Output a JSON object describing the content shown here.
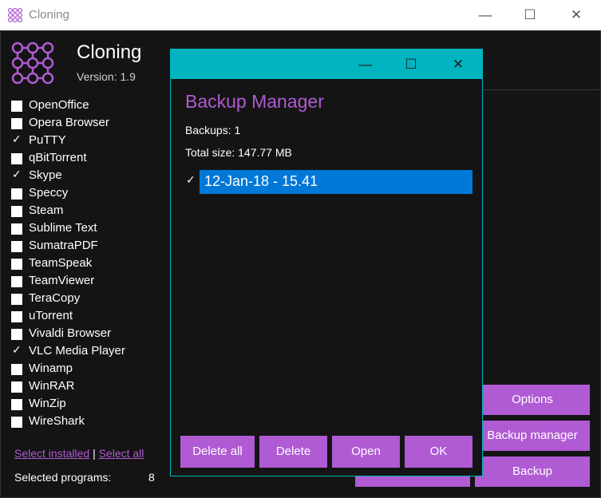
{
  "window": {
    "title": "Cloning"
  },
  "header": {
    "app_name": "Cloning",
    "version": "Version: 1.9"
  },
  "programs": [
    {
      "label": "OpenOffice",
      "checked": false
    },
    {
      "label": "Opera Browser",
      "checked": false
    },
    {
      "label": "PuTTY",
      "checked": true
    },
    {
      "label": "qBitTorrent",
      "checked": false
    },
    {
      "label": "Skype",
      "checked": true
    },
    {
      "label": "Speccy",
      "checked": false
    },
    {
      "label": "Steam",
      "checked": false
    },
    {
      "label": "Sublime Text",
      "checked": false
    },
    {
      "label": "SumatraPDF",
      "checked": false
    },
    {
      "label": "TeamSpeak",
      "checked": false
    },
    {
      "label": "TeamViewer",
      "checked": false
    },
    {
      "label": "TeraCopy",
      "checked": false
    },
    {
      "label": "uTorrent",
      "checked": false
    },
    {
      "label": "Vivaldi Browser",
      "checked": false
    },
    {
      "label": "VLC Media Player",
      "checked": true
    },
    {
      "label": "Winamp",
      "checked": false
    },
    {
      "label": "WinRAR",
      "checked": false
    },
    {
      "label": "WinZip",
      "checked": false
    },
    {
      "label": "WireShark",
      "checked": false
    }
  ],
  "links": {
    "select_installed": "Select installed",
    "separator": "|",
    "select_all": "Select all"
  },
  "selection": {
    "label": "Selected programs:",
    "count": "8"
  },
  "buttons": {
    "options": "Options",
    "backup_manager": "Backup manager",
    "backup": "Backup"
  },
  "colors": {
    "accent": "#b05ad4",
    "dialog_title": "#00b4c0",
    "selection": "#0078d7",
    "background": "#141414"
  },
  "dialog": {
    "heading": "Backup Manager",
    "backups_count": "Backups: 1",
    "total_size": "Total size: 147.77 MB",
    "backups": [
      {
        "label": "12-Jan-18  - 15.41",
        "checked": true
      }
    ],
    "buttons": {
      "delete_all": "Delete all",
      "delete": "Delete",
      "open": "Open",
      "ok": "OK"
    }
  }
}
